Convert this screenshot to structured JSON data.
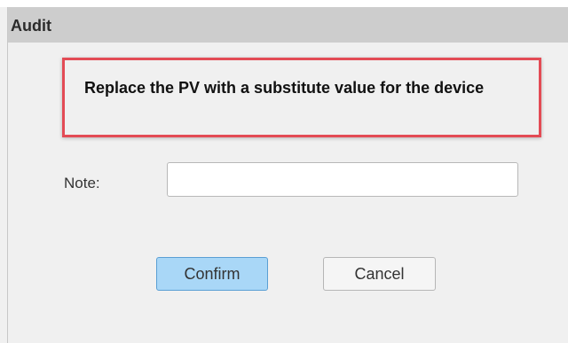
{
  "dialog": {
    "title": "Audit",
    "message": "Replace the PV with a substitute value for the device",
    "note_label": "Note:",
    "note_value": "",
    "note_placeholder": "",
    "confirm_label": "Confirm",
    "cancel_label": "Cancel"
  },
  "colors": {
    "titlebar": "#cdcdcd",
    "highlight_border": "#e34b55",
    "confirm_bg": "#a9d7f7",
    "confirm_border": "#5a9fd4"
  }
}
